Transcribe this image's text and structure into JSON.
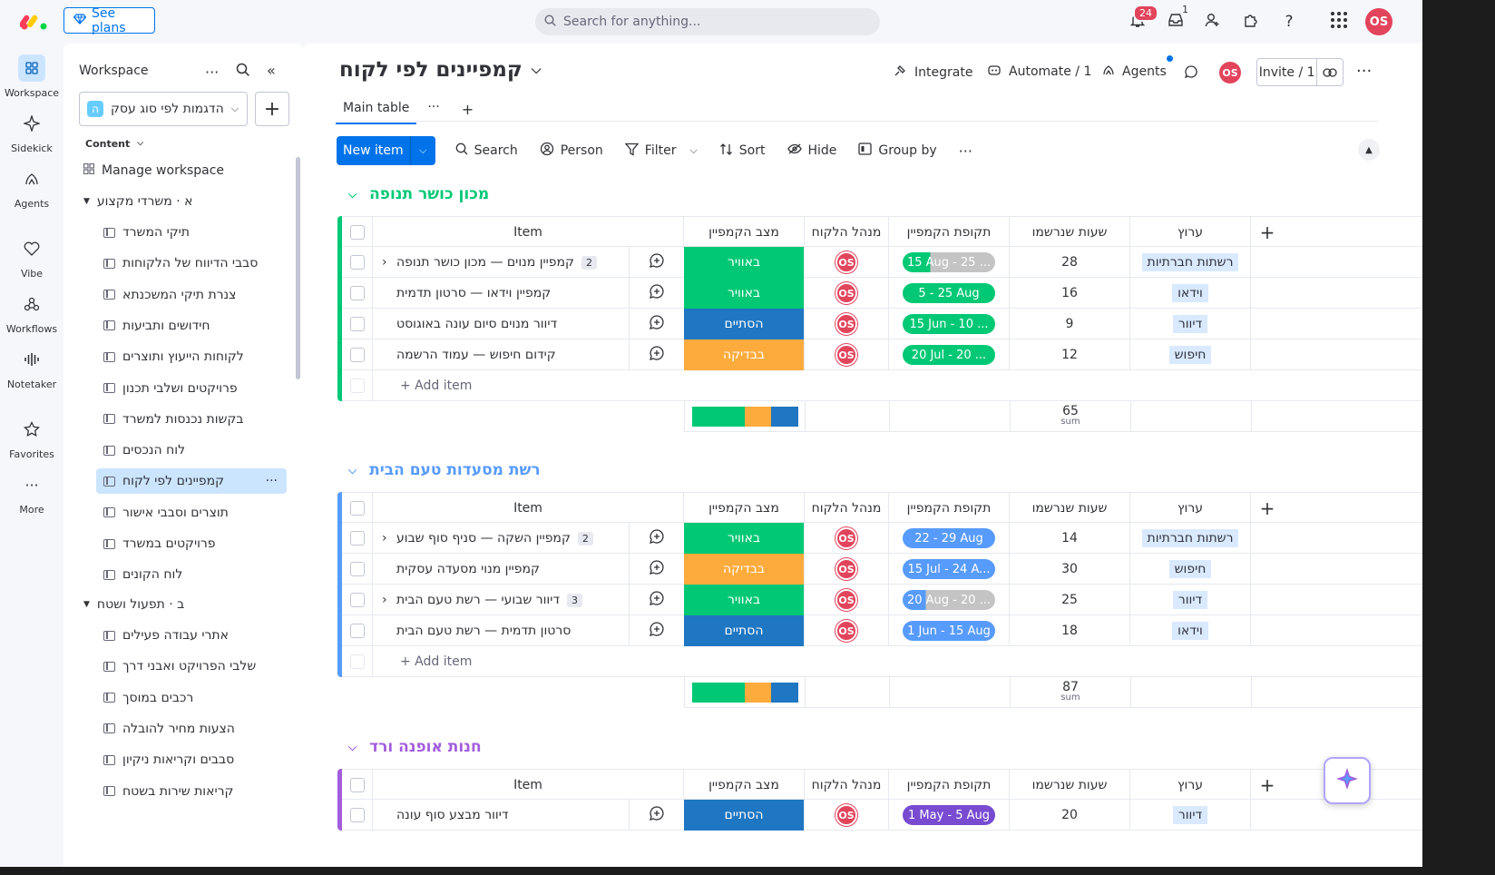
{
  "topbar": {
    "see_plans": "See plans",
    "search_placeholder": "Search for anything...",
    "notif_count": "24",
    "inbox_count": "1",
    "avatar": "OS"
  },
  "rail": [
    {
      "label": "Workspace",
      "icon": "grid-icon"
    },
    {
      "label": "Sidekick",
      "icon": "sparkle-icon"
    },
    {
      "label": "Agents",
      "icon": "agents-icon"
    },
    {
      "label": "Vibe",
      "icon": "heart-icon"
    },
    {
      "label": "Workflows",
      "icon": "workflows-icon"
    },
    {
      "label": "Notetaker",
      "icon": "audio-icon"
    },
    {
      "label": "Favorites",
      "icon": "star-icon"
    },
    {
      "label": "More",
      "icon": "more-icon"
    }
  ],
  "side": {
    "title": "Workspace",
    "workspace_name": "הדגמות לפי סוג עסק",
    "workspace_letter": "ה",
    "content_label": "Content",
    "manage": "Manage workspace",
    "folder_a": "א · משרדי מקצוע",
    "boards_a": [
      "תיקי המשרד",
      "סבבי הדיווח של הלקוחות",
      "צנרת תיקי המשכנתא",
      "חידושים ותביעות",
      "לקוחות הייעוץ ותוצרים",
      "פרויקטים ושלבי תכנון",
      "בקשות נכנסות למשרד",
      "לוח הנכסים",
      "קמפיינים לפי לקוח",
      "תוצרים וסבבי אישור",
      "פרויקטים במשרד",
      "לוח הקונים"
    ],
    "folder_b": "ב · תפעול ושטח",
    "boards_b": [
      "אתרי עבודה פעילים",
      "שלבי הפרויקט ואבני דרך",
      "רכבים במוסך",
      "הצעות מחיר להובלה",
      "סבבים וקריאות ניקיון",
      "קריאות שירות בשטח"
    ]
  },
  "header": {
    "title": "קמפיינים לפי לקוח",
    "integrate": "Integrate",
    "automate": "Automate / 1",
    "agents": "Agents",
    "avatar": "OS",
    "invite": "Invite / 1",
    "tab_main": "Main table"
  },
  "toolbar": {
    "new_item": "New item",
    "search": "Search",
    "person": "Person",
    "filter": "Filter",
    "sort": "Sort",
    "hide": "Hide",
    "group_by": "Group by"
  },
  "columns": {
    "item": "Item",
    "status": "מצב הקמפיין",
    "manager": "מנהל הלקוח",
    "period": "תקופת הקמפיין",
    "hours": "שעות שנרשמו",
    "channel": "ערוץ"
  },
  "colors": {
    "done": "#037f4c",
    "working": "#00c875",
    "stuck": "#fdab3d",
    "finished": "#1f76c2"
  },
  "groups": [
    {
      "name": "מכון כושר תנופה",
      "color": "#00c875",
      "add_item": "+ Add item",
      "sum": "65",
      "sum_label": "sum",
      "rows": [
        {
          "name": "קמפיין מנוים — מכון כושר תנופה",
          "sub": "2",
          "status": "באוויר",
          "status_color": "#00c875",
          "manager": "OS",
          "period": "15 Aug - 25 ...",
          "period_color": "#00c875",
          "progress": 0.3,
          "hours": "28",
          "channel": "רשתות חברתיות"
        },
        {
          "name": "קמפיין וידאו — סרטון תדמית",
          "sub": "",
          "status": "באוויר",
          "status_color": "#00c875",
          "manager": "OS",
          "period": "5 - 25 Aug",
          "period_color": "#00c875",
          "progress": 1,
          "hours": "16",
          "channel": "וידאו"
        },
        {
          "name": "דיוור מנוים סיום עונה באוגוסט",
          "sub": "",
          "status": "הסתיים",
          "status_color": "#1f76c2",
          "manager": "OS",
          "period": "15 Jun - 10 ...",
          "period_color": "#00c875",
          "progress": 1,
          "hours": "9",
          "channel": "דיוור"
        },
        {
          "name": "קידום חיפוש — עמוד הרשמה",
          "sub": "",
          "status": "בבדיקה",
          "status_color": "#fdab3d",
          "manager": "OS",
          "period": "20 Jul - 20 ...",
          "period_color": "#00c875",
          "progress": 1,
          "hours": "12",
          "channel": "חיפוש"
        }
      ],
      "summary": [
        0.5,
        0.25,
        0.25
      ]
    },
    {
      "name": "רשת מסעדות טעם הבית",
      "color": "#579bfc",
      "add_item": "+ Add item",
      "sum": "87",
      "sum_label": "sum",
      "rows": [
        {
          "name": "קמפיין השקה — סניף סוף שבוע",
          "sub": "2",
          "status": "באוויר",
          "status_color": "#00c875",
          "manager": "OS",
          "period": "22 - 29 Aug",
          "period_color": "#579bfc",
          "progress": 1,
          "hours": "14",
          "channel": "רשתות חברתיות"
        },
        {
          "name": "קמפיין מנוי מסעדה עסקית",
          "sub": "",
          "status": "בבדיקה",
          "status_color": "#fdab3d",
          "manager": "OS",
          "period": "15 Jul - 24 A...",
          "period_color": "#579bfc",
          "progress": 1,
          "hours": "30",
          "channel": "חיפוש"
        },
        {
          "name": "דיוור שבועי — רשת טעם הבית",
          "sub": "3",
          "status": "באוויר",
          "status_color": "#00c875",
          "manager": "OS",
          "period": "20 Aug - 20 ...",
          "period_color": "#579bfc",
          "progress": 0.25,
          "hours": "25",
          "channel": "דיוור"
        },
        {
          "name": "סרטון תדמית — רשת טעם הבית",
          "sub": "",
          "status": "הסתיים",
          "status_color": "#1f76c2",
          "manager": "OS",
          "period": "1 Jun - 15 Aug",
          "period_color": "#579bfc",
          "progress": 1,
          "hours": "18",
          "channel": "וידאו"
        }
      ],
      "summary": [
        0.5,
        0.25,
        0.25
      ]
    },
    {
      "name": "חנות אופנה ורד",
      "color": "#a25ddc",
      "rows": [
        {
          "name": "דיוור מבצע סוף עונה",
          "sub": "",
          "status": "הסתיים",
          "status_color": "#1f76c2",
          "manager": "OS",
          "period": "1 May - 5 Aug",
          "period_color": "#784bd1",
          "progress": 1,
          "hours": "20",
          "channel": "דיוור"
        }
      ]
    }
  ]
}
